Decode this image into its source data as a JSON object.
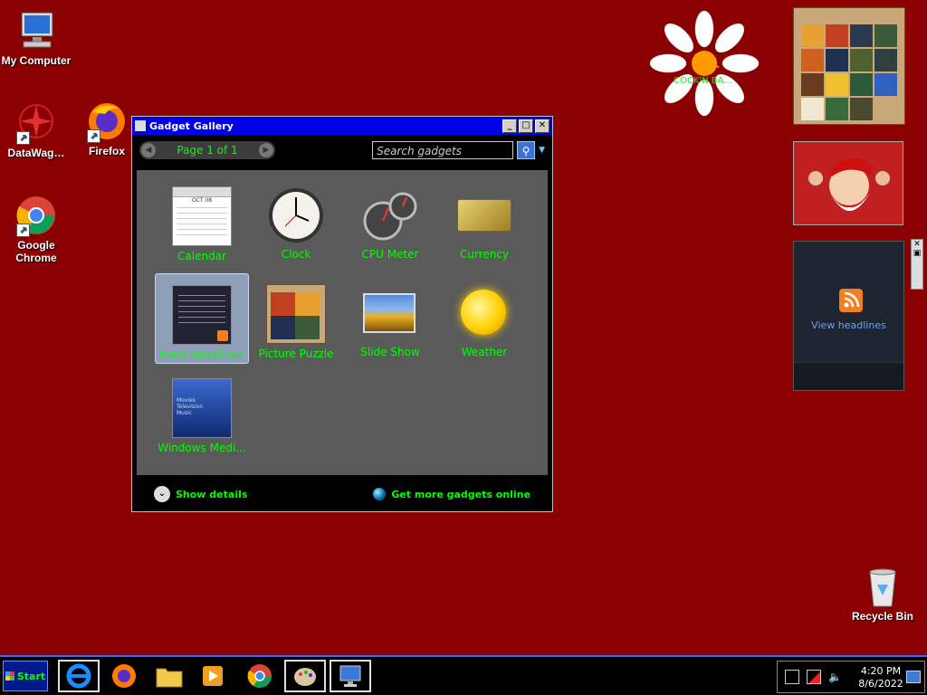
{
  "desktop": {
    "icons": [
      {
        "label": "My Computer",
        "icon": "computer-icon"
      },
      {
        "label": "DataWag…",
        "icon": "datawag-icon"
      },
      {
        "label": "Firefox",
        "icon": "firefox-icon"
      },
      {
        "label": "Google Chrome",
        "icon": "chrome-icon"
      },
      {
        "label": "Recycle Bin",
        "icon": "recycle-bin-icon"
      }
    ],
    "background_color": "#8b0000"
  },
  "clock_gadget": {
    "text": "COCK'N BA..."
  },
  "feed_gadget": {
    "label": "View headlines"
  },
  "gallery": {
    "title": "Gadget Gallery",
    "page_label": "Page 1 of 1",
    "search_placeholder": "Search gadgets",
    "gadgets": [
      {
        "name": "Calendar",
        "icon": "calendar-icon"
      },
      {
        "name": "Clock",
        "icon": "clock-icon"
      },
      {
        "name": "CPU Meter",
        "icon": "cpu-meter-icon"
      },
      {
        "name": "Currency",
        "icon": "currency-icon"
      },
      {
        "name": "Feed Headlines",
        "icon": "feed-icon",
        "selected": true
      },
      {
        "name": "Picture Puzzle",
        "icon": "puzzle-icon"
      },
      {
        "name": "Slide Show",
        "icon": "slideshow-icon"
      },
      {
        "name": "Weather",
        "icon": "sun-icon"
      },
      {
        "name": "Windows Medi...",
        "icon": "media-center-icon"
      }
    ],
    "calendar_month": "OCT 08",
    "media_lines": [
      "Movies",
      "Television",
      "Music"
    ],
    "show_details": "Show details",
    "get_more": "Get more gadgets online"
  },
  "taskbar": {
    "start_label": "Start",
    "apps": [
      "ie-icon",
      "firefox-icon",
      "folder-icon",
      "media-player-icon",
      "chrome-icon",
      "paint-icon",
      "display-icon"
    ],
    "time": "4:20 PM",
    "date": "8/6/2022"
  },
  "colors": {
    "accent_green": "#00ff00",
    "titlebar_blue": "#0000e8",
    "taskbar_border": "#4466ff"
  }
}
